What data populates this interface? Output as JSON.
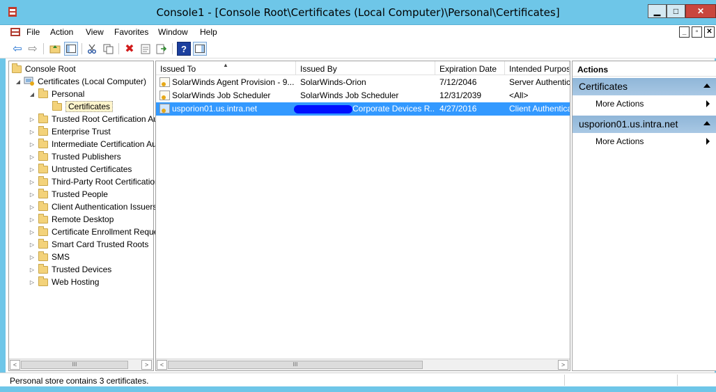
{
  "window": {
    "title": "Console1 - [Console Root\\Certificates (Local Computer)\\Personal\\Certificates]",
    "min_glyph": "▁",
    "max_glyph": "□",
    "close_glyph": "✕"
  },
  "menu": {
    "items": [
      "File",
      "Action",
      "View",
      "Favorites",
      "Window",
      "Help"
    ],
    "child_controls": [
      "_",
      "▫",
      "✕"
    ]
  },
  "toolbar": {
    "icons": [
      "back-icon",
      "forward-icon",
      "up-folder-icon",
      "show-hide-tree-icon",
      "cut-icon",
      "copy-icon",
      "delete-icon",
      "properties-icon",
      "export-icon",
      "help-icon",
      "show-hide-action-pane-icon"
    ],
    "glyphs": {
      "back": "⇦",
      "forward": "⇨",
      "delete": "✖",
      "help": "?"
    }
  },
  "tree": {
    "root": "Console Root",
    "computer": "Certificates (Local Computer)",
    "personal": "Personal",
    "selected": "Certificates",
    "stores": [
      "Trusted Root Certification Authorities",
      "Enterprise Trust",
      "Intermediate Certification Authorities",
      "Trusted Publishers",
      "Untrusted Certificates",
      "Third-Party Root Certification Authorities",
      "Trusted People",
      "Client Authentication Issuers",
      "Remote Desktop",
      "Certificate Enrollment Requests",
      "Smart Card Trusted Roots",
      "SMS",
      "Trusted Devices",
      "Web Hosting"
    ],
    "expander_collapsed": "▷",
    "expander_expanded": "◢"
  },
  "list": {
    "columns": [
      "Issued To",
      "Issued By",
      "Expiration Date",
      "Intended Purposes"
    ],
    "sort_glyph": "▲",
    "rows": [
      {
        "issued_to": "SolarWinds Agent Provision - 9...",
        "issued_by": "SolarWinds-Orion",
        "expiration": "7/12/2046",
        "purposes": "Server Authentication"
      },
      {
        "issued_to": "SolarWinds Job Scheduler",
        "issued_by": "SolarWinds Job Scheduler",
        "expiration": "12/31/2039",
        "purposes": "<All>"
      },
      {
        "issued_to": "usporion01.us.intra.net",
        "issued_by": "Corporate Devices R...",
        "expiration": "4/27/2016",
        "purposes": "Client Authentication"
      }
    ],
    "selected_row": 2
  },
  "scroll": {
    "left": "<",
    "right": ">",
    "thumb": "III"
  },
  "actions": {
    "title": "Actions",
    "sections": [
      {
        "label": "Certificates",
        "item": "More Actions"
      },
      {
        "label": "usporion01.us.intra.net",
        "item": "More Actions"
      }
    ]
  },
  "status": {
    "text": "Personal store contains 3 certificates."
  }
}
